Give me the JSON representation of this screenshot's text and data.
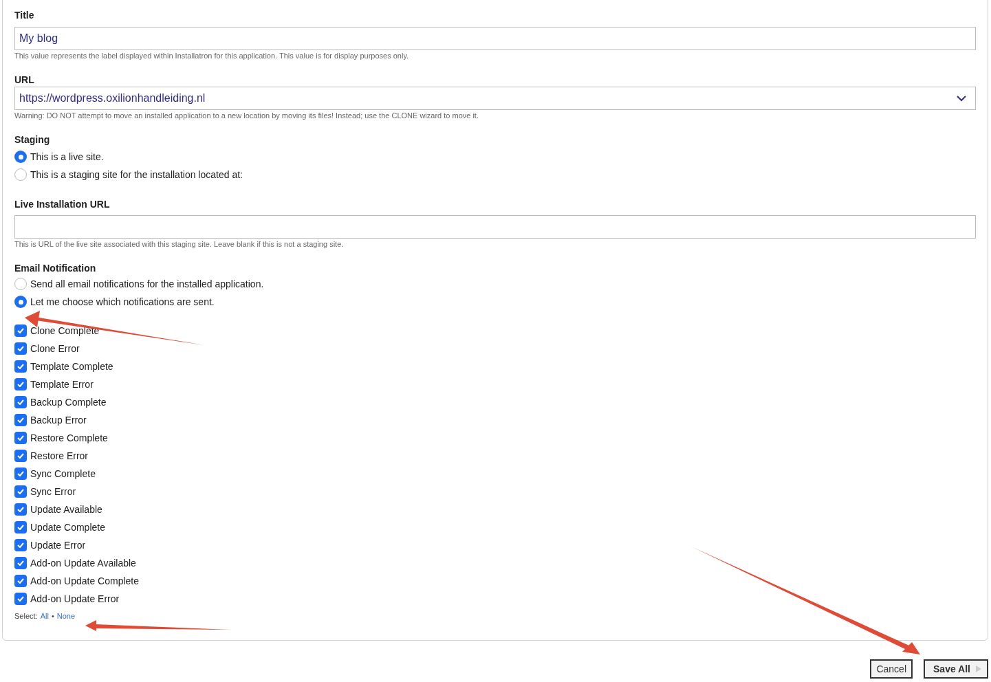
{
  "title_field": {
    "label": "Title",
    "value": "My blog",
    "help": "This value represents the label displayed within Installatron for this application. This value is for display purposes only."
  },
  "url_field": {
    "label": "URL",
    "value": "https://wordpress.oxilionhandleiding.nl",
    "help": "Warning: DO NOT attempt to move an installed application to a new location by moving its files! Instead; use the CLONE wizard to move it."
  },
  "staging": {
    "label": "Staging",
    "options": [
      {
        "label": "This is a live site.",
        "selected": true
      },
      {
        "label": "This is a staging site for the installation located at:",
        "selected": false
      }
    ]
  },
  "live_url_field": {
    "label": "Live Installation URL",
    "help": "This is URL of the live site associated with this staging site. Leave blank if this is not a staging site."
  },
  "email_notification": {
    "label": "Email Notification",
    "options": [
      {
        "label": "Send all email notifications for the installed application.",
        "selected": false
      },
      {
        "label": "Let me choose which notifications are sent.",
        "selected": true
      }
    ],
    "notifications": [
      {
        "label": "Clone Complete",
        "checked": true
      },
      {
        "label": "Clone Error",
        "checked": true
      },
      {
        "label": "Template Complete",
        "checked": true
      },
      {
        "label": "Template Error",
        "checked": true
      },
      {
        "label": "Backup Complete",
        "checked": true
      },
      {
        "label": "Backup Error",
        "checked": true
      },
      {
        "label": "Restore Complete",
        "checked": true
      },
      {
        "label": "Restore Error",
        "checked": true
      },
      {
        "label": "Sync Complete",
        "checked": true
      },
      {
        "label": "Sync Error",
        "checked": true
      },
      {
        "label": "Update Available",
        "checked": true
      },
      {
        "label": "Update Complete",
        "checked": true
      },
      {
        "label": "Update Error",
        "checked": true
      },
      {
        "label": "Add-on Update Available",
        "checked": true
      },
      {
        "label": "Add-on Update Complete",
        "checked": true
      },
      {
        "label": "Add-on Update Error",
        "checked": true
      }
    ],
    "select": {
      "label": "Select:",
      "all": "All",
      "separator": "•",
      "none": "None"
    }
  },
  "buttons": {
    "cancel": "Cancel",
    "save": "Save All"
  }
}
